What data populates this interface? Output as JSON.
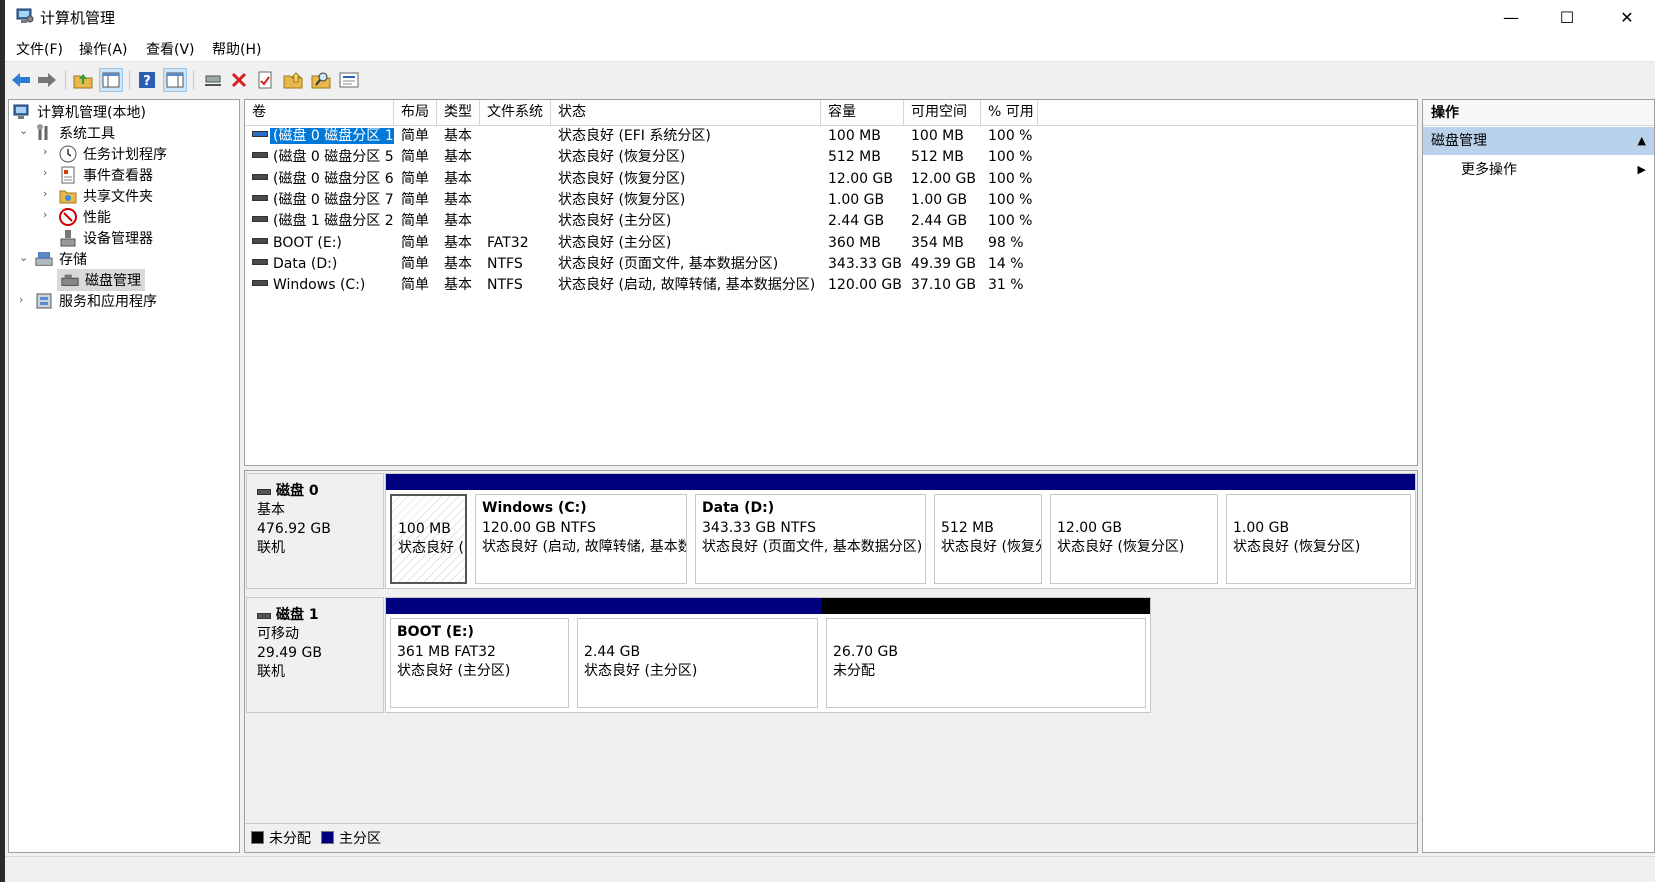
{
  "window": {
    "title": "计算机管理",
    "minimize": "—",
    "maximize": "☐",
    "close": "✕"
  },
  "menu": [
    {
      "label": "文件(F)"
    },
    {
      "label": "操作(A)"
    },
    {
      "label": "查看(V)"
    },
    {
      "label": "帮助(H)"
    }
  ],
  "toolbar": [
    {
      "icon": "back-arrow-icon"
    },
    {
      "icon": "forward-arrow-icon"
    },
    {
      "icon": "up-folder-icon"
    },
    {
      "icon": "show-hide-tree-icon"
    },
    {
      "icon": "help-icon"
    },
    {
      "icon": "show-hide-action-pane-icon"
    },
    {
      "icon": "connect-drive-icon"
    },
    {
      "icon": "delete-icon"
    },
    {
      "icon": "properties-icon"
    },
    {
      "icon": "open-folder-icon"
    },
    {
      "icon": "search-folder-icon"
    },
    {
      "icon": "settings-list-icon"
    }
  ],
  "tree": [
    {
      "label": "计算机管理(本地)",
      "icon": "computer-management-icon"
    },
    {
      "label": "系统工具",
      "icon": "system-tools-icon",
      "chev": "⌄"
    },
    {
      "label": "任务计划程序",
      "icon": "task-scheduler-icon",
      "chev": "›"
    },
    {
      "label": "事件查看器",
      "icon": "event-viewer-icon",
      "chev": "›"
    },
    {
      "label": "共享文件夹",
      "icon": "shared-folders-icon",
      "chev": "›"
    },
    {
      "label": "性能",
      "icon": "performance-icon",
      "chev": "›"
    },
    {
      "label": "设备管理器",
      "icon": "device-manager-icon"
    },
    {
      "label": "存储",
      "icon": "storage-icon",
      "chev": "⌄"
    },
    {
      "label": "磁盘管理",
      "icon": "disk-management-icon",
      "selected": true
    },
    {
      "label": "服务和应用程序",
      "icon": "services-applications-icon",
      "chev": "›"
    }
  ],
  "list": {
    "headers": [
      "卷",
      "布局",
      "类型",
      "文件系统",
      "状态",
      "容量",
      "可用空间",
      "% 可用"
    ],
    "rows": [
      {
        "vol": "(磁盘 0 磁盘分区 1)",
        "layout": "简单",
        "type": "基本",
        "fs": "",
        "status": "状态良好 (EFI 系统分区)",
        "cap": "100 MB",
        "free": "100 MB",
        "pct": "100 %",
        "selected": true
      },
      {
        "vol": "(磁盘 0 磁盘分区 5)",
        "layout": "简单",
        "type": "基本",
        "fs": "",
        "status": "状态良好 (恢复分区)",
        "cap": "512 MB",
        "free": "512 MB",
        "pct": "100 %"
      },
      {
        "vol": "(磁盘 0 磁盘分区 6)",
        "layout": "简单",
        "type": "基本",
        "fs": "",
        "status": "状态良好 (恢复分区)",
        "cap": "12.00 GB",
        "free": "12.00 GB",
        "pct": "100 %"
      },
      {
        "vol": "(磁盘 0 磁盘分区 7)",
        "layout": "简单",
        "type": "基本",
        "fs": "",
        "status": "状态良好 (恢复分区)",
        "cap": "1.00 GB",
        "free": "1.00 GB",
        "pct": "100 %"
      },
      {
        "vol": "(磁盘 1 磁盘分区 2)",
        "layout": "简单",
        "type": "基本",
        "fs": "",
        "status": "状态良好 (主分区)",
        "cap": "2.44 GB",
        "free": "2.44 GB",
        "pct": "100 %"
      },
      {
        "vol": "BOOT (E:)",
        "layout": "简单",
        "type": "基本",
        "fs": "FAT32",
        "status": "状态良好 (主分区)",
        "cap": "360 MB",
        "free": "354 MB",
        "pct": "98 %"
      },
      {
        "vol": "Data (D:)",
        "layout": "简单",
        "type": "基本",
        "fs": "NTFS",
        "status": "状态良好 (页面文件, 基本数据分区)",
        "cap": "343.33 GB",
        "free": "49.39 GB",
        "pct": "14 %"
      },
      {
        "vol": "Windows (C:)",
        "layout": "简单",
        "type": "基本",
        "fs": "NTFS",
        "status": "状态良好 (启动, 故障转储, 基本数据分区)",
        "cap": "120.00 GB",
        "free": "37.10 GB",
        "pct": "31 %"
      }
    ]
  },
  "disks": [
    {
      "name": "磁盘 0",
      "kind": "基本",
      "size": "476.92 GB",
      "state": "联机",
      "partitions": [
        {
          "name": "",
          "line1": "100 MB",
          "line2": "状态良好 (EFI 系统分区)",
          "style": "primary",
          "hatched": true
        },
        {
          "name": "Windows  (C:)",
          "line1": "120.00 GB NTFS",
          "line2": "状态良好 (启动, 故障转储, 基本数据分区)",
          "style": "primary"
        },
        {
          "name": "Data  (D:)",
          "line1": "343.33 GB NTFS",
          "line2": "状态良好 (页面文件, 基本数据分区)",
          "style": "primary"
        },
        {
          "name": "",
          "line1": "512 MB",
          "line2": "状态良好 (恢复分区)",
          "style": "primary"
        },
        {
          "name": "",
          "line1": "12.00 GB",
          "line2": "状态良好 (恢复分区)",
          "style": "primary"
        },
        {
          "name": "",
          "line1": "1.00 GB",
          "line2": "状态良好 (恢复分区)",
          "style": "primary"
        }
      ]
    },
    {
      "name": "磁盘 1",
      "kind": "可移动",
      "size": "29.49 GB",
      "state": "联机",
      "partitions": [
        {
          "name": "BOOT  (E:)",
          "line1": "361 MB FAT32",
          "line2": "状态良好 (主分区)",
          "style": "primary"
        },
        {
          "name": "",
          "line1": "2.44 GB",
          "line2": "状态良好 (主分区)",
          "style": "primary"
        },
        {
          "name": "",
          "line1": "26.70 GB",
          "line2": "未分配",
          "style": "unallocated"
        }
      ]
    }
  ],
  "legend": [
    {
      "label": "未分配",
      "color": "#000000"
    },
    {
      "label": "主分区",
      "color": "#00007f"
    }
  ],
  "actions": {
    "header": "操作",
    "section": "磁盘管理",
    "section_arrow": "▲",
    "item": "更多操作",
    "item_arrow": "▶"
  },
  "colors": {
    "selection": "#0078d7",
    "primary_partition": "#00007f",
    "unallocated": "#000000",
    "actions_section": "#b9d1ea"
  }
}
